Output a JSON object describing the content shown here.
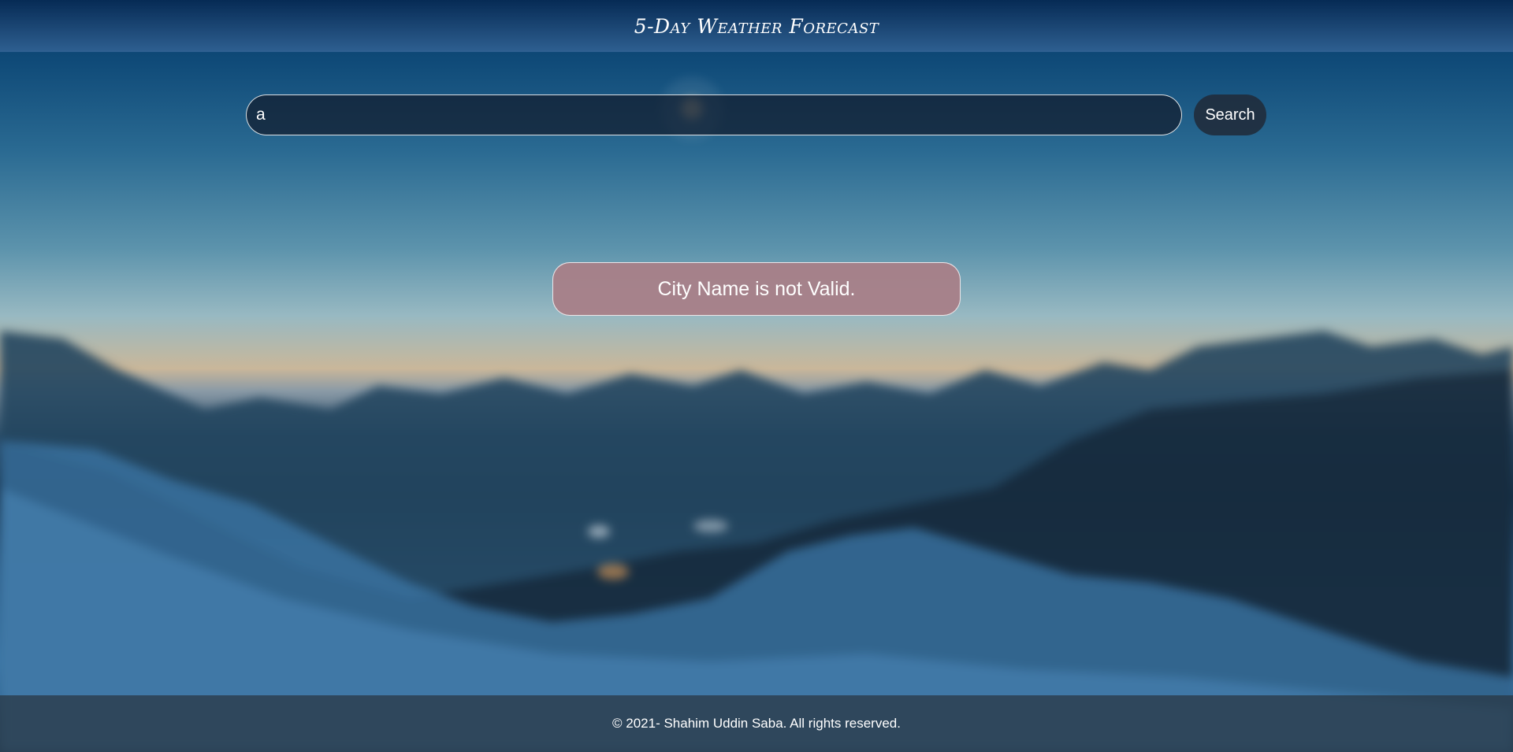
{
  "header": {
    "title": "5-Day Weather Forecast"
  },
  "search": {
    "value": "a",
    "button_label": "Search"
  },
  "error": {
    "message": "City Name is not Valid."
  },
  "footer": {
    "copyright": "© 2021- Shahim Uddin Saba. All rights reserved."
  },
  "colors": {
    "header_bg": "#0a2f5c",
    "error_bg": "#a88088",
    "button_bg": "#202c3c",
    "footer_bg": "#283440"
  }
}
